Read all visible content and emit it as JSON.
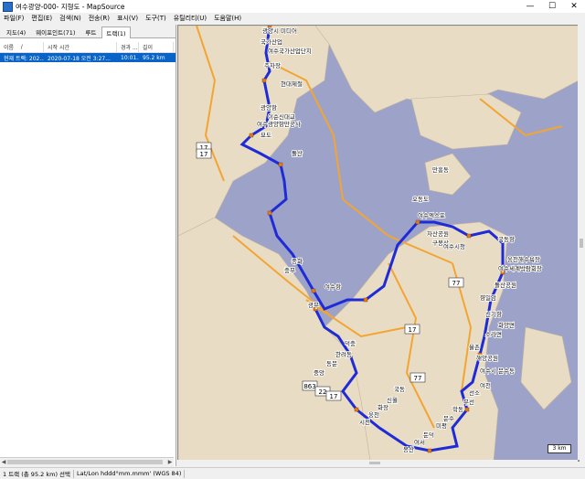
{
  "window": {
    "title": "여수광양-000- 지형도 - MapSource",
    "minimize": "—",
    "maximize": "☐",
    "close": "✕"
  },
  "menu": [
    "파일(F)",
    "편집(E)",
    "검색(N)",
    "전송(R)",
    "표시(V)",
    "도구(T)",
    "유틸리티(U)",
    "도움말(H)"
  ],
  "tabs": [
    "지도(4)",
    "웨이포인트(71)",
    "루트",
    "트랙(1)"
  ],
  "active_tab": 3,
  "track_table": {
    "headers": [
      "이름",
      "시작 시간",
      "경과 ...",
      "길이"
    ],
    "sort_indicator": "/",
    "rows": [
      {
        "name": "현재 트랙: 202...",
        "start": "2020-07-18 오전 3:27...",
        "elapsed": "10:01...",
        "length": "95.2 km"
      }
    ]
  },
  "status": {
    "summary": "1 트랙 (총 95.2 km) 선택",
    "coords": "Lat/Lon hddd°mm.mmm' (WGS 84)"
  },
  "map": {
    "scale_label": "3 km",
    "water_color": "#9da3c8",
    "land_color": "#e9dcc4",
    "track_color": "#1f2bd6",
    "road_labels": [
      "17",
      "17",
      "77",
      "77",
      "17",
      "863",
      "22",
      "17"
    ],
    "place_labels": [
      "광양시 미디어",
      "국가산업",
      "여수국가산업단지",
      "주차장",
      "현대제철",
      "광양항",
      "이순신대교",
      "여수광양항만공사",
      "묘도",
      "돌산",
      "만흥동",
      "오동도",
      "여수엑스포",
      "자산공원",
      "구봉산",
      "여수시청",
      "국동항",
      "웅천해수욕장",
      "여수세계박람회장",
      "돌산공원",
      "향일암",
      "신기항",
      "화양면",
      "소라면",
      "율촌",
      "해양공원",
      "여수시 문수동",
      "여천",
      "선소",
      "무선",
      "학동",
      "문수",
      "미평",
      "둔덕",
      "여서",
      "봉산",
      "국동",
      "신월",
      "화장",
      "웅천",
      "시전",
      "덕충",
      "한려동",
      "동문",
      "중앙",
      "광무",
      "여수항",
      "종화",
      "충무"
    ]
  }
}
